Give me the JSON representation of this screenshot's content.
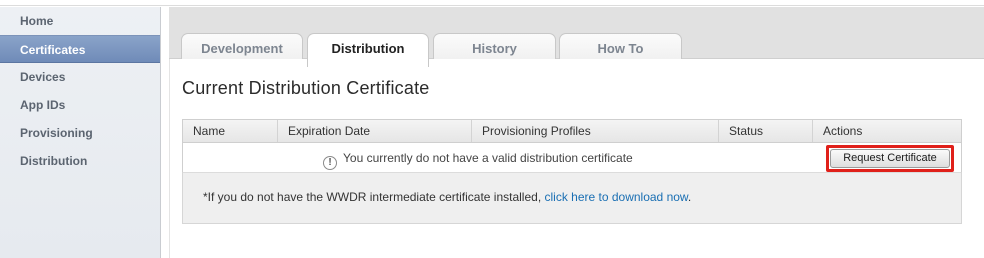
{
  "sidebar": {
    "items": [
      {
        "label": "Home",
        "active": false
      },
      {
        "label": "Certificates",
        "active": true
      },
      {
        "label": "Devices",
        "active": false
      },
      {
        "label": "App IDs",
        "active": false
      },
      {
        "label": "Provisioning",
        "active": false
      },
      {
        "label": "Distribution",
        "active": false
      }
    ]
  },
  "tabs": [
    {
      "label": "Development",
      "active": false
    },
    {
      "label": "Distribution",
      "active": true
    },
    {
      "label": "History",
      "active": false
    },
    {
      "label": "How To",
      "active": false
    }
  ],
  "main": {
    "title": "Current Distribution Certificate",
    "table": {
      "columns": [
        "Name",
        "Expiration Date",
        "Provisioning Profiles",
        "Status",
        "Actions"
      ],
      "empty_message": "You currently do not have a valid distribution certificate",
      "warning_glyph": "!",
      "action_button": "Request Certificate"
    },
    "note": {
      "text_before": "*If you do not have the WWDR intermediate certificate installed, ",
      "link_text": "click here to download now",
      "text_after": "."
    }
  },
  "colors": {
    "active_sidebar": "#7a95bf",
    "link": "#1a6fb3",
    "highlight": "#e0201a"
  }
}
